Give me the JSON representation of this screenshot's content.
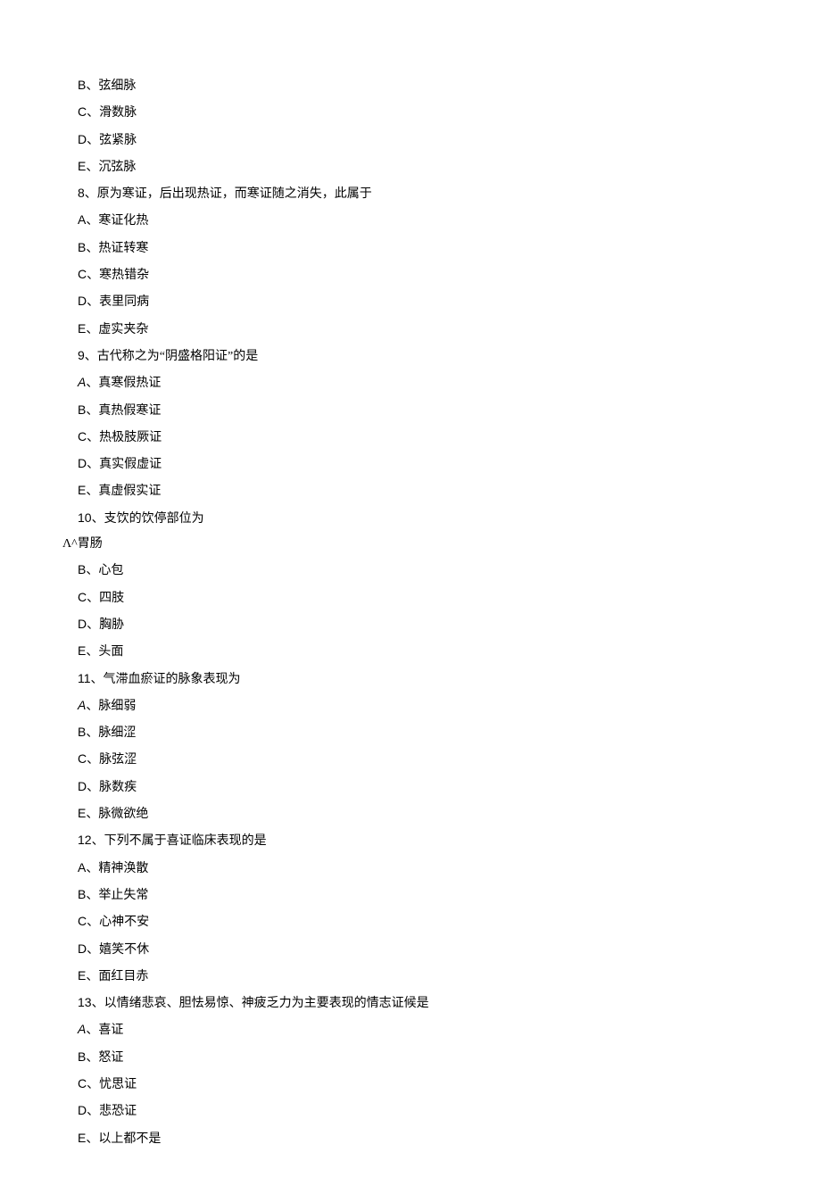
{
  "lines": [
    {
      "prefix": "B",
      "prefixClass": "option-label",
      "sep": "、",
      "text": "弦细脉"
    },
    {
      "prefix": "C",
      "prefixClass": "option-label",
      "sep": "、",
      "text": "滑数脉"
    },
    {
      "prefix": "D",
      "prefixClass": "option-label",
      "sep": "、",
      "text": "弦紧脉"
    },
    {
      "prefix": "E",
      "prefixClass": "option-label",
      "sep": "、",
      "text": "沉弦脉"
    },
    {
      "prefix": "8",
      "prefixClass": "question-num",
      "sep": "、",
      "text": "原为寒证，后出现热证，而寒证随之消失，此属于"
    },
    {
      "prefix": "A",
      "prefixClass": "option-label",
      "sep": "、",
      "text": "寒证化热"
    },
    {
      "prefix": "B",
      "prefixClass": "option-label",
      "sep": "、",
      "text": "热证转寒"
    },
    {
      "prefix": "C",
      "prefixClass": "option-label",
      "sep": "、",
      "text": "寒热错杂"
    },
    {
      "prefix": "D",
      "prefixClass": "option-label",
      "sep": "、",
      "text": "表里同病"
    },
    {
      "prefix": "E",
      "prefixClass": "option-label",
      "sep": "、",
      "text": "虚实夹杂"
    },
    {
      "prefix": "9",
      "prefixClass": "question-num",
      "sep": "、",
      "text": "古代称之为“阴盛格阳证”的是"
    },
    {
      "prefix": "A",
      "prefixClass": "italic-a",
      "sep": "、",
      "text": "真寒假热证"
    },
    {
      "prefix": "B",
      "prefixClass": "option-label",
      "sep": "、",
      "text": "真热假寒证"
    },
    {
      "prefix": "C",
      "prefixClass": "option-label",
      "sep": "、",
      "text": "热极肢厥证"
    },
    {
      "prefix": "D",
      "prefixClass": "option-label",
      "sep": "、",
      "text": "真实假虚证"
    },
    {
      "prefix": "E",
      "prefixClass": "option-label",
      "sep": "、",
      "text": "真虚假实证"
    },
    {
      "prefix": "10",
      "prefixClass": "question-num",
      "sep": "、",
      "text": "支饮的饮停部位为"
    },
    {
      "prefix": "Λ^",
      "prefixClass": "special-a",
      "sep": "",
      "text": "胃肠",
      "outdent": true
    },
    {
      "prefix": "B",
      "prefixClass": "option-label",
      "sep": "、",
      "text": "心包"
    },
    {
      "prefix": "C",
      "prefixClass": "option-label",
      "sep": "、",
      "text": "四肢"
    },
    {
      "prefix": "D",
      "prefixClass": "option-label",
      "sep": "、",
      "text": "胸胁"
    },
    {
      "prefix": "E",
      "prefixClass": "option-label",
      "sep": "、",
      "text": "头面"
    },
    {
      "prefix": "11",
      "prefixClass": "question-num",
      "sep": "、",
      "text": "气滞血瘀证的脉象表现为"
    },
    {
      "prefix": "A",
      "prefixClass": "italic-a",
      "sep": "、",
      "text": "脉细弱"
    },
    {
      "prefix": "B",
      "prefixClass": "option-label",
      "sep": "、",
      "text": "脉细涩"
    },
    {
      "prefix": "C",
      "prefixClass": "option-label",
      "sep": "、",
      "text": "脉弦涩"
    },
    {
      "prefix": "D",
      "prefixClass": "option-label",
      "sep": "、",
      "text": "脉数疾"
    },
    {
      "prefix": "E",
      "prefixClass": "option-label",
      "sep": "、",
      "text": "脉微欲绝"
    },
    {
      "prefix": "12",
      "prefixClass": "question-num",
      "sep": "、",
      "text": "下列不属于喜证临床表现的是"
    },
    {
      "prefix": "A",
      "prefixClass": "option-label",
      "sep": "、",
      "text": "精神涣散"
    },
    {
      "prefix": "B",
      "prefixClass": "option-label",
      "sep": "、",
      "text": "举止失常"
    },
    {
      "prefix": "C",
      "prefixClass": "option-label",
      "sep": "、",
      "text": "心神不安"
    },
    {
      "prefix": "D",
      "prefixClass": "option-label",
      "sep": "、",
      "text": "嬉笑不休"
    },
    {
      "prefix": "E",
      "prefixClass": "option-label",
      "sep": "、",
      "text": "面红目赤"
    },
    {
      "prefix": "13",
      "prefixClass": "question-num",
      "sep": "、",
      "text": "以情绪悲哀、胆怯易惊、神疲乏力为主要表现的情志证候是"
    },
    {
      "prefix": "A",
      "prefixClass": "italic-a",
      "sep": "、",
      "text": "喜证"
    },
    {
      "prefix": "B",
      "prefixClass": "option-label",
      "sep": "、",
      "text": "怒证"
    },
    {
      "prefix": "C",
      "prefixClass": "option-label",
      "sep": "、",
      "text": "忧思证"
    },
    {
      "prefix": "D",
      "prefixClass": "option-label",
      "sep": "、",
      "text": "悲恐证"
    },
    {
      "prefix": "E",
      "prefixClass": "option-label",
      "sep": "、",
      "text": "以上都不是"
    }
  ]
}
